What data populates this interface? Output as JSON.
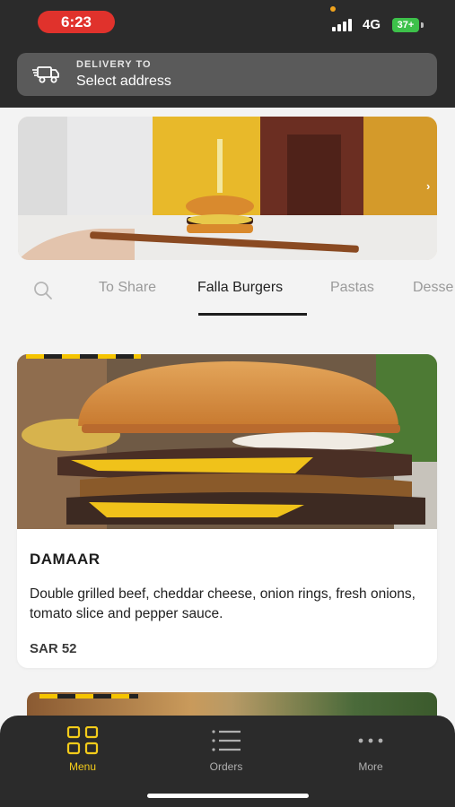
{
  "status_bar": {
    "time": "6:23",
    "network": "4G",
    "battery": "37+"
  },
  "delivery": {
    "label": "DELIVERY TO",
    "address": "Select address"
  },
  "banner": {
    "icon": "chevron-right-icon"
  },
  "tabs": [
    {
      "label": "To Share",
      "active": false
    },
    {
      "label": "Falla Burgers",
      "active": true
    },
    {
      "label": "Pastas",
      "active": false
    },
    {
      "label": "Desse",
      "active": false
    }
  ],
  "product": {
    "name": "DAMAAR",
    "description": "Double grilled beef, cheddar cheese, onion rings, fresh onions, tomato slice and pepper sauce.",
    "price": "SAR 52"
  },
  "bottom_nav": [
    {
      "label": "Menu",
      "icon": "grid-icon",
      "active": true
    },
    {
      "label": "Orders",
      "icon": "list-icon",
      "active": false
    },
    {
      "label": "More",
      "icon": "more-icon",
      "active": false
    }
  ],
  "colors": {
    "accent": "#f4cc1a",
    "header": "#2b2b2b",
    "time_pill": "#e0322c",
    "battery": "#3dc14a"
  }
}
